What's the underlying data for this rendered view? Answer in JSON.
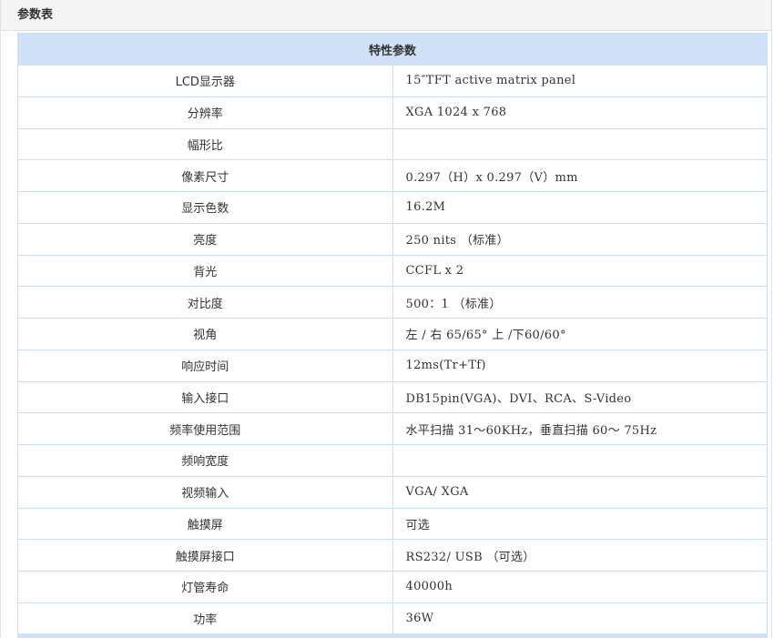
{
  "panel": {
    "title": "参数表"
  },
  "table": {
    "header": "特性参数",
    "rows": [
      {
        "label": "LCD显示器",
        "value": "15″TFT active matrix panel"
      },
      {
        "label": "分辨率",
        "value": "XGA 1024 x 768"
      },
      {
        "label": "幅形比",
        "value": ""
      },
      {
        "label": "像素尺寸",
        "value": "0.297（H）x 0.297（V）mm"
      },
      {
        "label": "显示色数",
        "value": "16.2M"
      },
      {
        "label": "亮度",
        "value": "250 nits （标准）"
      },
      {
        "label": "背光",
        "value": "CCFL x 2"
      },
      {
        "label": "对比度",
        "value": "500：1 （标准）"
      },
      {
        "label": "视角",
        "value": "左 / 右 65/65°  上 /下60/60°"
      },
      {
        "label": "响应时间",
        "value": "12ms(Tr+Tf)"
      },
      {
        "label": "输入接口",
        "value": "DB15pin(VGA)、DVI、RCA、S-Video"
      },
      {
        "label": "频率使用范围",
        "value": "水平扫描 31～60KHz，垂直扫描 60～ 75Hz"
      },
      {
        "label": "频响宽度",
        "value": ""
      },
      {
        "label": "视频输入",
        "value": "VGA/ XGA"
      },
      {
        "label": "触摸屏",
        "value": "可选"
      },
      {
        "label": "触摸屏接口",
        "value": "RS232/ USB （可选）"
      },
      {
        "label": "灯管寿命",
        "value": "40000h"
      },
      {
        "label": "功率",
        "value": "36W"
      }
    ]
  },
  "colors": {
    "header_bg": "#f4f4f4",
    "table_head_bg": "#cfe0f7",
    "table_border": "#cfdef3",
    "text": "#333333"
  }
}
